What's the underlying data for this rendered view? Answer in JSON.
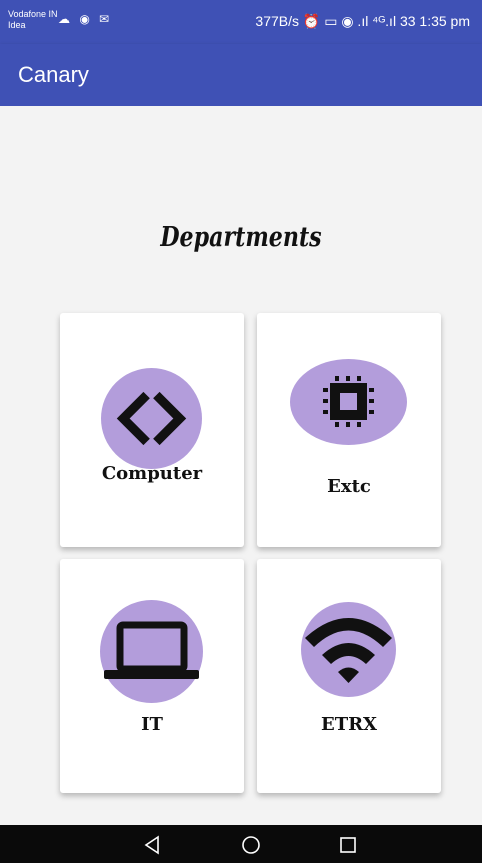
{
  "status_bar": {
    "carrier_line1": "Vodafone IN",
    "carrier_line2": "Idea",
    "left_icons": "☁ ◉ ✉",
    "right_text": "377B/s ⏰ ▭ ◉ .ıl ⁴ᴳ.ıl 33 1:35 pm"
  },
  "app_bar": {
    "title": "Canary"
  },
  "heading": "Departments",
  "departments": [
    {
      "label": "Computer",
      "icon": "code-icon"
    },
    {
      "label": "Extc",
      "icon": "chip-icon"
    },
    {
      "label": "IT",
      "icon": "laptop-icon"
    },
    {
      "label": "ETRX",
      "icon": "wifi-icon"
    }
  ],
  "colors": {
    "primary": "#3f51b5",
    "icon_circle": "#b39ddb",
    "background": "#f3f3f3"
  },
  "nav_bar": {
    "back": "back-icon",
    "home": "home-icon",
    "recents": "recents-icon"
  }
}
